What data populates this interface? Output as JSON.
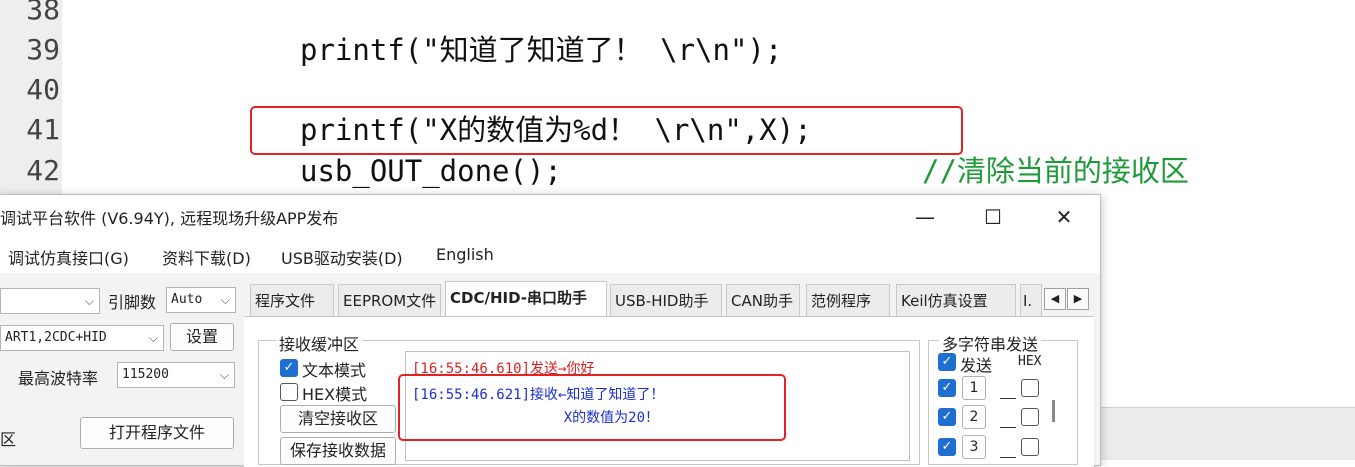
{
  "editor": {
    "lines": [
      {
        "num": "38",
        "code": ""
      },
      {
        "num": "39",
        "code": "printf(\"知道了知道了！ \\r\\n\");"
      },
      {
        "num": "40",
        "code": ""
      },
      {
        "num": "41",
        "code": "printf(\"X的数值为%d！ \\r\\n\",X);"
      },
      {
        "num": "42",
        "code": "usb_OUT_done();"
      }
    ],
    "comment": "//清除当前的接收区"
  },
  "window": {
    "title": "调试平台软件 (V6.94Y), 远程现场升级APP发布",
    "controls": {
      "minimize": "—",
      "maximize": "☐",
      "close": "✕"
    }
  },
  "menu": [
    "调试仿真接口(G)",
    "资料下载(D)",
    "USB驱动安装(D)",
    "English"
  ],
  "left_panel": {
    "combo1_value": "",
    "baud_label": "引脚数",
    "baud_value": "Auto",
    "port_value": "ART1,2CDC+HID",
    "settings_label": "设置",
    "max_baud_label": "最高波特率",
    "max_baud_value": "115200",
    "area_label": "区",
    "open_file_label": "打开程序文件"
  },
  "tabs": [
    "程序文件",
    "EEPROM文件",
    "CDC/HID-串口助手",
    "USB-HID助手",
    "CAN助手",
    "范例程序",
    "Keil仿真设置",
    "I."
  ],
  "tab_arrows": {
    "left": "◀",
    "right": "▶"
  },
  "receive": {
    "group_label": "接收缓冲区",
    "text_mode_label": "文本模式",
    "hex_mode_label": "HEX模式",
    "clear_label": "清空接收区",
    "save_label": "保存接收数据",
    "lines": [
      {
        "text": "[16:55:46.610]发送→你好",
        "color": "#e02020"
      },
      {
        "text": "[16:55:46.621]接收←知道了知道了！",
        "color": "#1a2fd0"
      },
      {
        "text": "                  X的数值为20！",
        "color": "#1a2fd0"
      }
    ]
  },
  "multi_send": {
    "group_label": "多字符串发送",
    "send_label": "发送",
    "hex_label": "HEX",
    "rows": [
      "1",
      "2",
      "3"
    ]
  },
  "colors": {
    "highlight": "#e02424",
    "comment": "#1f9a3a",
    "checkbox": "#1e6fd0"
  }
}
